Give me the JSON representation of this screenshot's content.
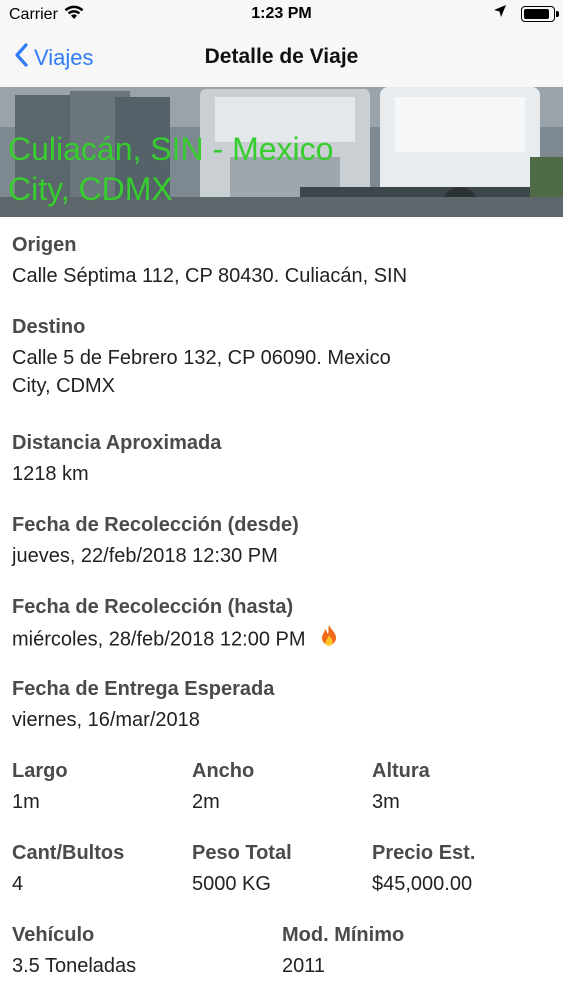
{
  "status_bar": {
    "carrier": "Carrier",
    "time": "1:23 PM",
    "battery_level": 0.9
  },
  "nav": {
    "back_label": "Viajes",
    "title": "Detalle de Viaje"
  },
  "hero": {
    "title_line1": "Culiacán, SIN - Mexico",
    "title_line2": "City, CDMX",
    "title_color": "#36ce2c"
  },
  "details": {
    "origin_label": "Origen",
    "origin_value": "Calle Séptima 112, CP 80430. Culiacán, SIN",
    "destination_label": "Destino",
    "destination_line1": "Calle 5 de Febrero 132, CP 06090. Mexico",
    "destination_line2": "City, CDMX",
    "distance_label": "Distancia Aproximada",
    "distance_value": "1218 km",
    "pickup_from_label": "Fecha de Recolección (desde)",
    "pickup_from_value": "jueves, 22/feb/2018 12:30 PM",
    "pickup_to_label": "Fecha de Recolección (hasta)",
    "pickup_to_value": "miércoles, 28/feb/2018 12:00 PM",
    "delivery_label": "Fecha de Entrega Esperada",
    "delivery_value": "viernes, 16/mar/2018",
    "length_label": "Largo",
    "length_value": "1m",
    "width_label": "Ancho",
    "width_value": "2m",
    "height_label": "Altura",
    "height_value": "3m",
    "packages_label": "Cant/Bultos",
    "packages_value": "4",
    "weight_label": "Peso Total",
    "weight_value": "5000 KG",
    "price_label": "Precio Est.",
    "price_value": "$45,000.00",
    "vehicle_label": "Vehículo",
    "vehicle_value": "3.5 Toneladas",
    "model_label": "Mod. Mínimo",
    "model_value": "2011"
  },
  "colors": {
    "accent": "#2f7cf6",
    "hero_text": "#36ce2c",
    "urgent_icon": "fire-icon"
  }
}
